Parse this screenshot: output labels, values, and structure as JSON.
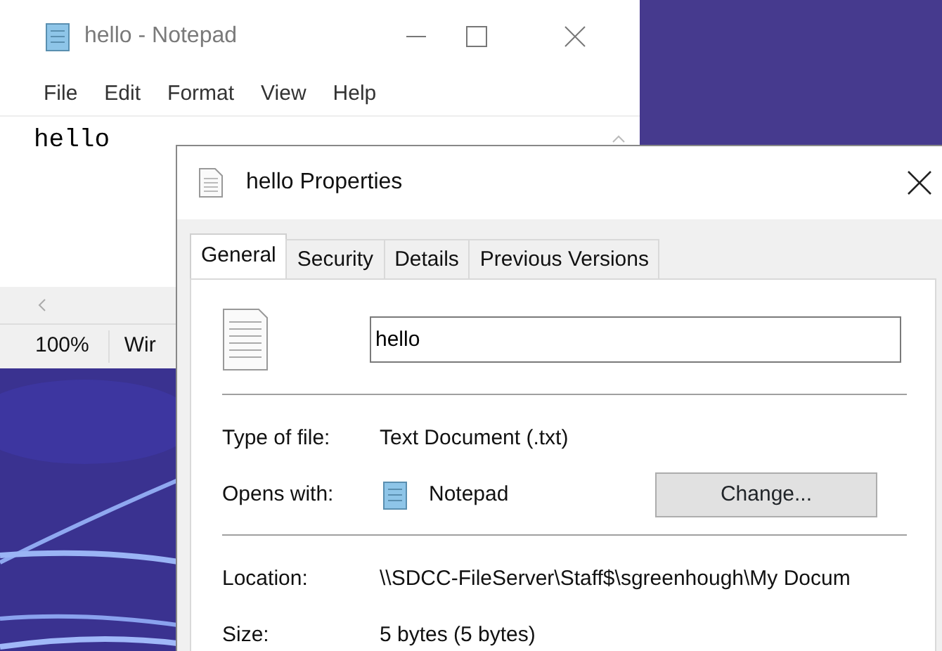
{
  "notepad": {
    "title": "hello - Notepad",
    "menu": [
      "File",
      "Edit",
      "Format",
      "View",
      "Help"
    ],
    "content": "hello",
    "status_bar": [
      "100%",
      "Wir"
    ]
  },
  "properties": {
    "title": "hello Properties",
    "tabs": [
      {
        "label": "General",
        "selected": true
      },
      {
        "label": "Security",
        "selected": false
      },
      {
        "label": "Details",
        "selected": false
      },
      {
        "label": "Previous Versions",
        "selected": false
      }
    ],
    "file_name": "hello",
    "sections": [
      [
        {
          "label": "Type of file:",
          "value": "Text Document (.txt)",
          "kind": "text"
        },
        {
          "label": "Opens with:",
          "value": "Notepad",
          "kind": "app",
          "button": "Change..."
        }
      ],
      [
        {
          "label": "Location:",
          "value": "\\\\SDCC-FileServer\\Staff$\\sgreenhough\\My Docum",
          "kind": "text"
        },
        {
          "label": "Size:",
          "value": "5 bytes (5 bytes)",
          "kind": "text"
        }
      ]
    ]
  }
}
